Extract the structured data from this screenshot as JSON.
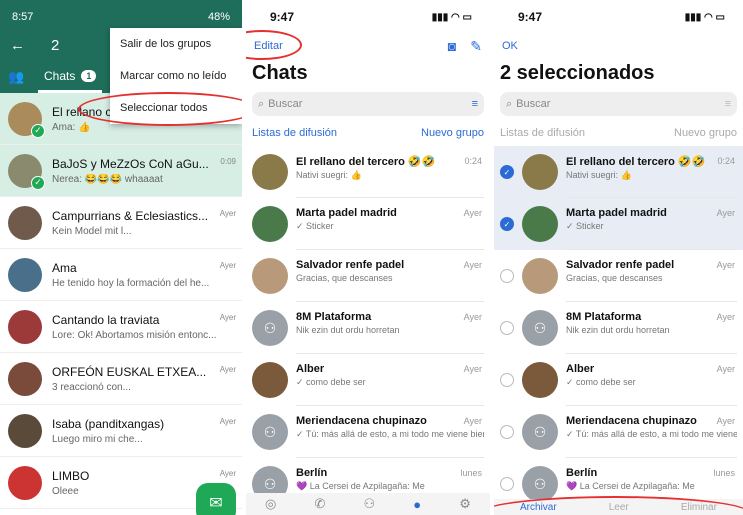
{
  "android": {
    "time": "8:57",
    "battery": "48%",
    "selected_count": "2",
    "tab_chats": "Chats",
    "tab_badge": "1",
    "menu": [
      "Salir de los grupos",
      "Marcar como no leído",
      "Seleccionar todos"
    ],
    "chats": [
      {
        "name": "El rellano c",
        "msg": "Ama: 👍",
        "time": "",
        "selected": true,
        "color": "#a98b5c"
      },
      {
        "name": "BaJoS y MeZzOs CoN aGu...",
        "msg": "Nerea: 😂😂😂 whaaaat",
        "time": "0:09",
        "selected": true,
        "color": "#8a8a6e"
      },
      {
        "name": "Campurrians & Eclesiastics...",
        "msg": "Kein Model mit l...",
        "time": "Ayer",
        "selected": false,
        "color": "#6f5a4c"
      },
      {
        "name": "Ama",
        "msg": "He tenido hoy la formación del he...",
        "time": "Ayer",
        "selected": false,
        "color": "#4a6f8a"
      },
      {
        "name": "Cantando la traviata",
        "msg": "Lore: Ok! Abortamos misión entonc...",
        "time": "Ayer",
        "selected": false,
        "color": "#9c3a3a"
      },
      {
        "name": "ORFEÓN EUSKAL ETXEA...",
        "msg": "3 reaccionó con...",
        "time": "Ayer",
        "selected": false,
        "color": "#7a4a3a"
      },
      {
        "name": "Isaba (panditxangas)",
        "msg": "Luego miro mi che...",
        "time": "Ayer",
        "selected": false,
        "color": "#5a4a3a"
      },
      {
        "name": "LIMBO",
        "msg": "Oleee",
        "time": "Ayer",
        "selected": false,
        "color": "#c33"
      }
    ]
  },
  "ios_list": {
    "time": "9:47",
    "edit": "Editar",
    "title": "Chats",
    "search_placeholder": "Buscar",
    "broadcast": "Listas de difusión",
    "new_group": "Nuevo grupo",
    "chats": [
      {
        "name": "El rellano del tercero 🤣🤣",
        "msg": "Nativi suegri: 👍",
        "time": "0:24",
        "color": "#8a7a4a",
        "grey": false
      },
      {
        "name": "Marta padel madrid",
        "msg": "✓ Sticker",
        "time": "Ayer",
        "color": "#4a7a4a",
        "grey": false
      },
      {
        "name": "Salvador renfe padel",
        "msg": "Gracias, que descanses",
        "time": "Ayer",
        "color": "#b89a7a",
        "grey": false
      },
      {
        "name": "8M Plataforma",
        "msg": "Nik ezin dut ordu horretan",
        "time": "Ayer",
        "color": "#9aa0a8",
        "grey": true
      },
      {
        "name": "Alber",
        "msg": "✓ como debe ser",
        "time": "Ayer",
        "color": "#7a5a3a",
        "grey": false
      },
      {
        "name": "Meriendacena chupinazo",
        "msg": "✓ Tú: más allá de esto, a mi todo me viene bien :p",
        "time": "Ayer",
        "color": "#9aa0a8",
        "grey": true
      },
      {
        "name": "Berlín",
        "msg": "💜 La Cersei de Azpilagaña: Me",
        "time": "lunes",
        "color": "#9aa0a8",
        "grey": true
      }
    ]
  },
  "ios_select": {
    "time": "9:47",
    "ok": "OK",
    "title": "2 seleccionados",
    "search_placeholder": "Buscar",
    "broadcast": "Listas de difusión",
    "new_group": "Nuevo grupo",
    "actions": [
      "Archivar",
      "Leer",
      "Eliminar"
    ]
  }
}
